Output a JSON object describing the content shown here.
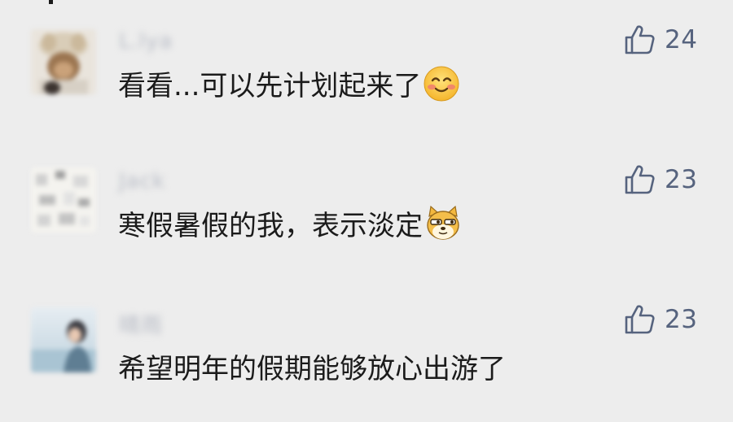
{
  "comments": [
    {
      "username": "L.lya",
      "text": "看看...可以先计划起来了",
      "emoji": "smiling-face-emoji",
      "likes": "24"
    },
    {
      "username": "Jack",
      "text": "寒假暑假的我，表示淡定",
      "emoji": "smug-doge-emoji",
      "likes": "23"
    },
    {
      "username": "晴雨",
      "text": "希望明年的假期能够放心出游了",
      "emoji": "",
      "likes": "23"
    }
  ],
  "like_icon": "thumbs-up-icon",
  "colors": {
    "background": "#ededed",
    "text": "#1b1b1b",
    "like": "#56637e",
    "username": "#b8bcc6"
  }
}
